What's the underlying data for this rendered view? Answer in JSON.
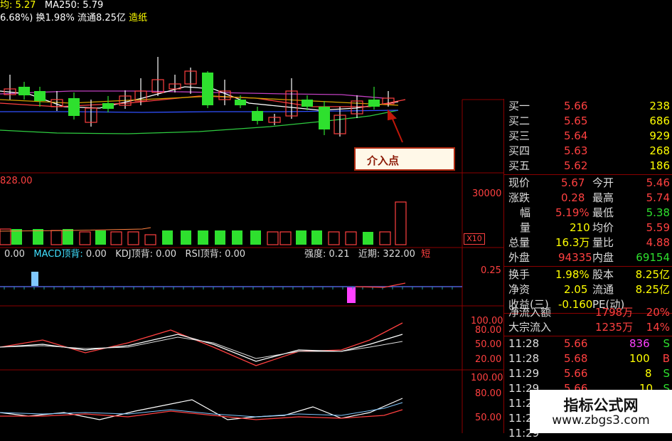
{
  "header": {
    "line1_a": "均: 5.27",
    "line1_b": "MA250: 5.79",
    "line2_a": "6.68%)",
    "line2_b": "换1.98%",
    "line2_c": "流通8.25亿",
    "line2_d": "造纸"
  },
  "annotation": {
    "label": "介入点"
  },
  "volume": {
    "left_value": "828.00",
    "axis_max": "30000",
    "x_label": "X10"
  },
  "indicator_bar": {
    "v0": "0.00",
    "macd_label": "MACD顶背:",
    "macd_value": "0.00",
    "kdj_label": "KDJ顶背:",
    "kdj_value": "0.00",
    "rsi_label": "RSI顶背:",
    "rsi_value": "0.00",
    "strength_label": "强度:",
    "strength_value": "0.21",
    "recent_label": "近期:",
    "recent_value": "322.00",
    "tag": "短"
  },
  "axes": {
    "macd": "0.25",
    "kdj": [
      "100.00",
      "80.00",
      "50.00",
      "20.00"
    ],
    "rsi": [
      "100.00",
      "80.00",
      "50.00"
    ]
  },
  "order_book": [
    {
      "label": "买一",
      "price": "5.66",
      "qty": "238"
    },
    {
      "label": "买二",
      "price": "5.65",
      "qty": "686"
    },
    {
      "label": "买三",
      "price": "5.64",
      "qty": "929"
    },
    {
      "label": "买四",
      "price": "5.63",
      "qty": "268"
    },
    {
      "label": "买五",
      "price": "5.62",
      "qty": "186"
    }
  ],
  "quote_stats": [
    {
      "l1": "现价",
      "v1": "5.67",
      "l2": "今开",
      "v2": "5.46"
    },
    {
      "l1": "涨跌",
      "v1": "0.28",
      "l2": "最高",
      "v2": "5.74"
    },
    {
      "l1": "幅",
      "v1": "5.19%",
      "l2": "最低",
      "v2": "5.38"
    },
    {
      "l1": "量",
      "v1": "210",
      "l2": "均价",
      "v2": "5.59"
    },
    {
      "l1": "总量",
      "v1": "16.3万",
      "l2": "量比",
      "v2": "4.88"
    },
    {
      "l1": "外盘",
      "v1": "94335",
      "l2": "内盘",
      "v2": "69154"
    }
  ],
  "fundamentals": [
    {
      "l1": "换手",
      "v1": "1.98%",
      "l2": "股本",
      "v2": "8.25亿"
    },
    {
      "l1": "净资",
      "v1": "2.05",
      "l2": "流通",
      "v2": "8.25亿"
    },
    {
      "l1": "收益(三)",
      "v1": "-0.160",
      "l2": "PE(动)",
      "v2": ""
    }
  ],
  "flows": [
    {
      "label": "净流入额",
      "value": "1798万",
      "pct": "20%"
    },
    {
      "label": "大宗流入",
      "value": "1235万",
      "pct": "14%"
    }
  ],
  "trades": [
    {
      "time": "11:28",
      "price": "5.66",
      "vol": "836",
      "side": "S"
    },
    {
      "time": "11:28",
      "price": "5.68",
      "vol": "100",
      "side": "B"
    },
    {
      "time": "11:29",
      "price": "5.66",
      "vol": "8",
      "side": "S"
    },
    {
      "time": "11:29",
      "price": "5.66",
      "vol": "10",
      "side": "S"
    },
    {
      "time": "11:29",
      "price": "",
      "vol": "",
      "side": ""
    },
    {
      "time": "11:29",
      "price": "",
      "vol": "",
      "side": ""
    },
    {
      "time": "11:29",
      "price": "",
      "vol": "",
      "side": ""
    }
  ],
  "watermark": {
    "title": "指标公式网",
    "url": "www.zbgs3.com"
  },
  "colors": {
    "red": "#ff4040",
    "green": "#2ee02e",
    "yellow": "#ffff00",
    "cyan": "#40e0ff",
    "magenta": "#ff40ff",
    "grid": "#8b0000"
  }
}
